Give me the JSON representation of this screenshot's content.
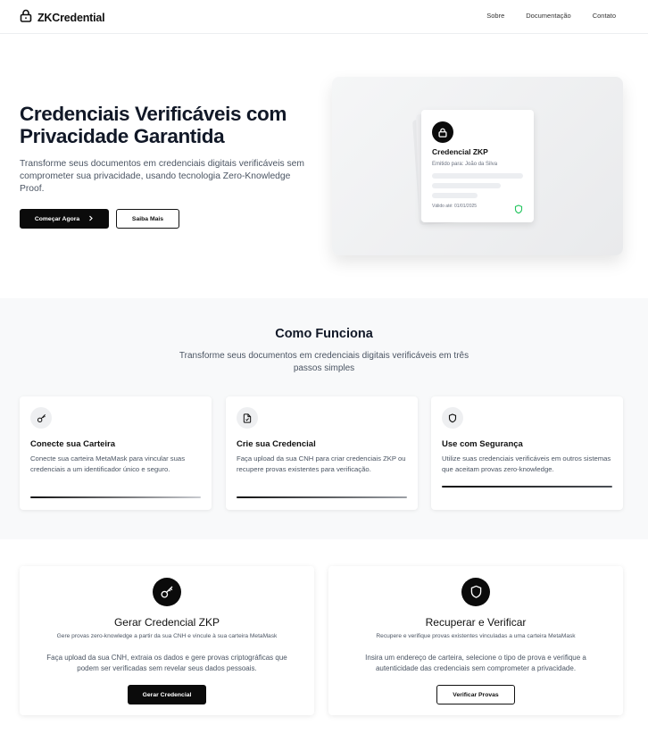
{
  "header": {
    "brand": "ZKCredential",
    "nav": [
      "Sobre",
      "Documentação",
      "Contato"
    ]
  },
  "hero": {
    "title": "Credenciais Verificáveis com Privacidade Garantida",
    "subtitle": "Transforme seus documentos em credenciais digitais verificáveis sem comprometer sua privacidade, usando tecnologia Zero-Knowledge Proof.",
    "primary_button": "Começar Agora",
    "secondary_button": "Saiba Mais",
    "card": {
      "title": "Credencial ZKP",
      "issued_to": "Emitido para: João da Silva",
      "valid_until": "Válido até: 01/01/2025"
    }
  },
  "how": {
    "title": "Como Funciona",
    "subtitle": "Transforme seus documentos em credenciais digitais verificáveis em três passos simples",
    "steps": [
      {
        "title": "Conecte sua Carteira",
        "text": "Conecte sua carteira MetaMask para vincular suas credenciais a um identificador único e seguro.",
        "icon": "key-icon"
      },
      {
        "title": "Crie sua Credencial",
        "text": "Faça upload da sua CNH para criar credenciais ZKP ou recupere provas existentes para verificação.",
        "icon": "document-icon"
      },
      {
        "title": "Use com Segurança",
        "text": "Utilize suas credenciais verificáveis em outros sistemas que aceitam provas zero-knowledge.",
        "icon": "shield-icon"
      }
    ]
  },
  "actions": [
    {
      "title": "Gerar Credencial ZKP",
      "description": "Gere provas zero-knowledge a partir da sua CNH e vincule à sua carteira MetaMask",
      "text": "Faça upload da sua CNH, extraia os dados e gere provas criptográficas que podem ser verificadas sem revelar seus dados pessoais.",
      "button": "Gerar Credencial",
      "icon": "key-icon"
    },
    {
      "title": "Recuperar e Verificar",
      "description": "Recupere e verifique provas existentes vinculadas a uma carteira MetaMask",
      "text": "Insira um endereço de carteira, selecione o tipo de prova e verifique a autenticidade das credenciais sem comprometer a privacidade.",
      "button": "Verificar Provas",
      "icon": "shield-icon"
    }
  ],
  "colors": {
    "primary": "#0b0b0b",
    "muted_text": "#4b5563",
    "section_bg": "#f8f9fa",
    "success": "#22c55e"
  }
}
